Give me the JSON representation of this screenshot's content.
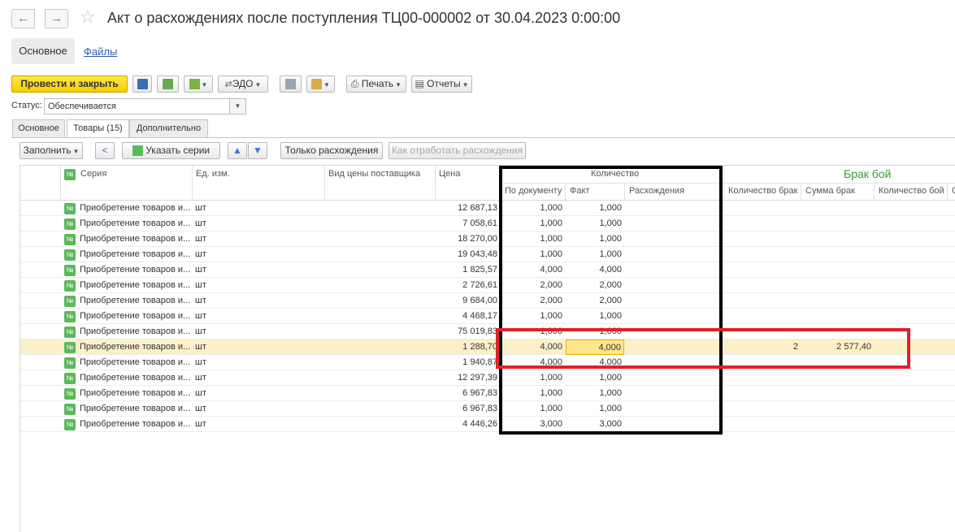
{
  "window": {
    "title": "Акт о расхождениях после поступления ТЦ00-000002 от 30.04.2023 0:00:00",
    "back_glyph": "←",
    "forward_glyph": "→",
    "star_glyph": "☆"
  },
  "sections": {
    "main": "Основное",
    "files": "Файлы"
  },
  "toolbar": {
    "post_close": "Провести и закрыть",
    "edo": "ЭДО",
    "print": "Печать",
    "reports": "Отчеты",
    "icons": [
      "save-icon",
      "post-icon",
      "create-based-icon",
      "edo-icon",
      "journal-icon",
      "attachments-icon",
      "print-icon",
      "reports-icon"
    ]
  },
  "status": {
    "label": "Статус:",
    "value": "Обеспечивается"
  },
  "inner_tabs": [
    "Основное",
    "Товары (15)",
    "Дополнительно"
  ],
  "table_toolbar": {
    "fill": "Заполнить",
    "set_series": "Указать серии",
    "only_diffs": "Только расхождения",
    "process_diffs": "Как отработать расхождения"
  },
  "columns": {
    "series": "Серия",
    "unit": "Ед. изм.",
    "price_type": "Вид цены поставщика",
    "price": "Цена",
    "qty_group": "Количество",
    "by_doc": "По документу",
    "fact": "Факт",
    "diffs": "Расхождения",
    "brak_group": "Брак бой",
    "qty_brak": "Количество брак",
    "sum_brak": "Сумма брак",
    "qty_boy": "Количество бой",
    "extra": "С"
  },
  "rows": [
    {
      "series": "Приобретение товаров и...",
      "unit": "шт",
      "price": "12 687,13",
      "doc": "1,000",
      "fact": "1,000",
      "qty_brak": "",
      "sum_brak": "",
      "selected": false
    },
    {
      "series": "Приобретение товаров и...",
      "unit": "шт",
      "price": "7 058,61",
      "doc": "1,000",
      "fact": "1,000",
      "qty_brak": "",
      "sum_brak": "",
      "selected": false
    },
    {
      "series": "Приобретение товаров и...",
      "unit": "шт",
      "price": "18 270,00",
      "doc": "1,000",
      "fact": "1,000",
      "qty_brak": "",
      "sum_brak": "",
      "selected": false
    },
    {
      "series": "Приобретение товаров и...",
      "unit": "шт",
      "price": "19 043,48",
      "doc": "1,000",
      "fact": "1,000",
      "qty_brak": "",
      "sum_brak": "",
      "selected": false
    },
    {
      "series": "Приобретение товаров и...",
      "unit": "шт",
      "price": "1 825,57",
      "doc": "4,000",
      "fact": "4,000",
      "qty_brak": "",
      "sum_brak": "",
      "selected": false
    },
    {
      "series": "Приобретение товаров и...",
      "unit": "шт",
      "price": "2 726,61",
      "doc": "2,000",
      "fact": "2,000",
      "qty_brak": "",
      "sum_brak": "",
      "selected": false
    },
    {
      "series": "Приобретение товаров и...",
      "unit": "шт",
      "price": "9 684,00",
      "doc": "2,000",
      "fact": "2,000",
      "qty_brak": "",
      "sum_brak": "",
      "selected": false
    },
    {
      "series": "Приобретение товаров и...",
      "unit": "шт",
      "price": "4 468,17",
      "doc": "1,000",
      "fact": "1,000",
      "qty_brak": "",
      "sum_brak": "",
      "selected": false
    },
    {
      "series": "Приобретение товаров и...",
      "unit": "шт",
      "price": "75 019,83",
      "doc": "1,000",
      "fact": "1,000",
      "qty_brak": "",
      "sum_brak": "",
      "selected": false
    },
    {
      "series": "Приобретение товаров и...",
      "unit": "шт",
      "price": "1 288,70",
      "doc": "4,000",
      "fact": "4,000",
      "qty_brak": "2",
      "sum_brak": "2 577,40",
      "selected": true
    },
    {
      "series": "Приобретение товаров и...",
      "unit": "шт",
      "price": "1 940,87",
      "doc": "4,000",
      "fact": "4,000",
      "qty_brak": "",
      "sum_brak": "",
      "selected": false
    },
    {
      "series": "Приобретение товаров и...",
      "unit": "шт",
      "price": "12 297,39",
      "doc": "1,000",
      "fact": "1,000",
      "qty_brak": "",
      "sum_brak": "",
      "selected": false
    },
    {
      "series": "Приобретение товаров и...",
      "unit": "шт",
      "price": "6 967,83",
      "doc": "1,000",
      "fact": "1,000",
      "qty_brak": "",
      "sum_brak": "",
      "selected": false
    },
    {
      "series": "Приобретение товаров и...",
      "unit": "шт",
      "price": "6 967,83",
      "doc": "1,000",
      "fact": "1,000",
      "qty_brak": "",
      "sum_brak": "",
      "selected": false
    },
    {
      "series": "Приобретение товаров и...",
      "unit": "шт",
      "price": "4 446,26",
      "doc": "3,000",
      "fact": "3,000",
      "qty_brak": "",
      "sum_brak": "",
      "selected": false
    }
  ],
  "colors": {
    "primary_button": "#f4cc00",
    "selected_row": "#fbf1c8",
    "highlight_black": "#000000",
    "highlight_red": "#e0202a",
    "brak_label": "#2f9e2f"
  }
}
